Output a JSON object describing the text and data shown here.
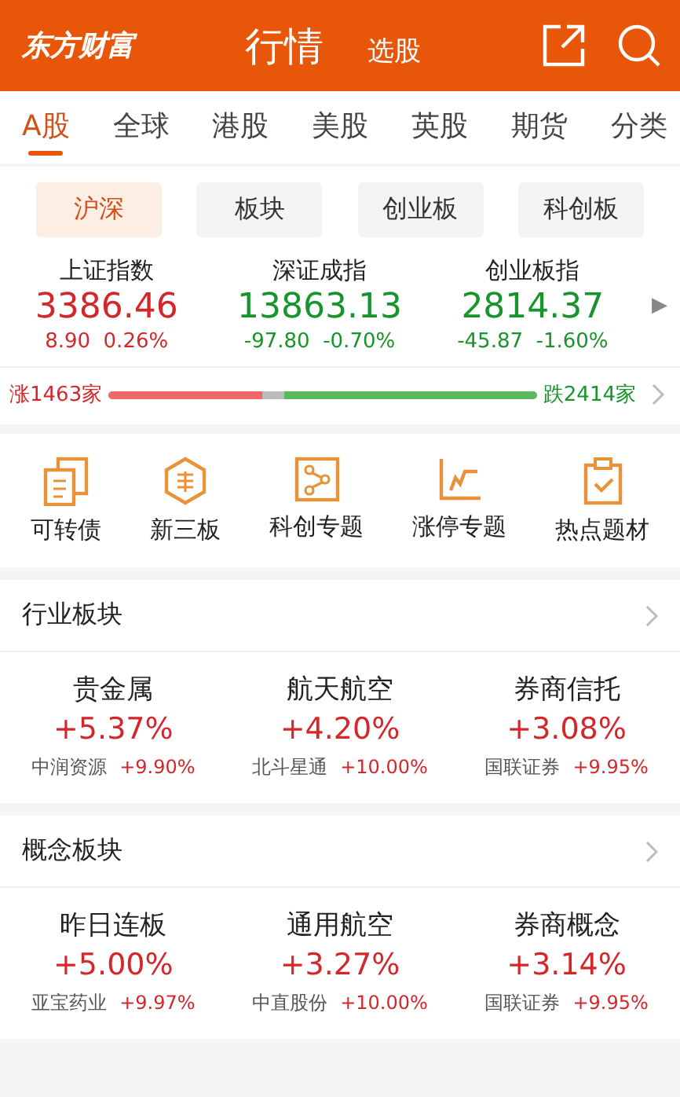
{
  "header": {
    "logo": "东方财富",
    "title": "行情",
    "subtitle": "选股"
  },
  "tabs": [
    {
      "label": "A股",
      "selected": true
    },
    {
      "label": "全球",
      "selected": false
    },
    {
      "label": "港股",
      "selected": false
    },
    {
      "label": "美股",
      "selected": false
    },
    {
      "label": "英股",
      "selected": false
    },
    {
      "label": "期货",
      "selected": false
    },
    {
      "label": "分类",
      "selected": false
    }
  ],
  "markets": [
    {
      "label": "沪深",
      "selected": true
    },
    {
      "label": "板块",
      "selected": false
    },
    {
      "label": "创业板",
      "selected": false
    },
    {
      "label": "科创板",
      "selected": false
    }
  ],
  "indices": [
    {
      "name": "上证指数",
      "value": "3386.46",
      "change": "8.90",
      "percent": "0.26%",
      "color": "#d3272b"
    },
    {
      "name": "深证成指",
      "value": "13863.13",
      "change": "-97.80",
      "percent": "-0.70%",
      "color": "#17942b"
    },
    {
      "name": "创业板指",
      "value": "2814.37",
      "change": "-45.87",
      "percent": "-1.60%",
      "color": "#17942b"
    }
  ],
  "indices_more": "▶",
  "breadth": {
    "rise": "涨1463家",
    "fall": "跌2414家",
    "rise_bar": {
      "level": 0.36
    },
    "fall_bar": {
      "level": 0.59
    }
  },
  "shortcuts": [
    {
      "label": "可转债",
      "kind": "bond"
    },
    {
      "label": "新三板",
      "kind": "hexagon"
    },
    {
      "label": "科创专题",
      "kind": "nodes"
    },
    {
      "label": "涨停专题",
      "kind": "chart"
    },
    {
      "label": "热点题材",
      "kind": "clipboard"
    }
  ],
  "sections": [
    {
      "title": "行业板块",
      "items": [
        {
          "name": "贵金属",
          "change": "+5.37%",
          "stock": "中润资源",
          "stock_change": "+9.90%"
        },
        {
          "name": "航天航空",
          "change": "+4.20%",
          "stock": "北斗星通",
          "stock_change": "+10.00%"
        },
        {
          "name": "券商信托",
          "change": "+3.08%",
          "stock": "国联证券",
          "stock_change": "+9.95%"
        }
      ]
    },
    {
      "title": "概念板块",
      "items": [
        {
          "name": "昨日连板",
          "change": "+5.00%",
          "stock": "亚宝药业",
          "stock_change": "+9.97%"
        },
        {
          "name": "通用航空",
          "change": "+3.27%",
          "stock": "中直股份",
          "stock_change": "+10.00%"
        },
        {
          "name": "券商概念",
          "change": "+3.14%",
          "stock": "国联证券",
          "stock_change": "+9.95%"
        }
      ]
    }
  ]
}
